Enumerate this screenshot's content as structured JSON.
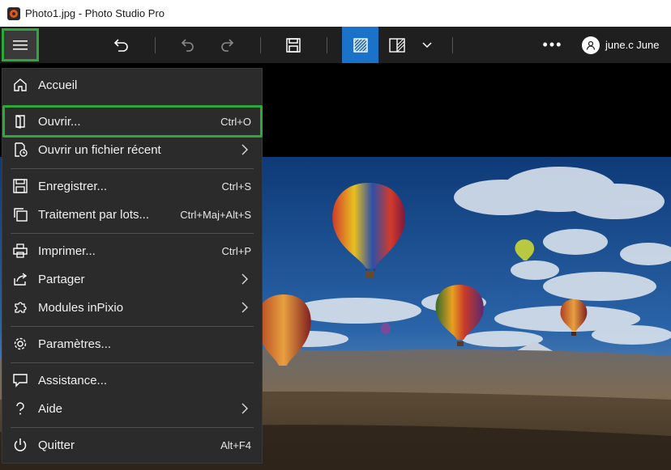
{
  "window": {
    "title": "Photo1.jpg - Photo Studio Pro"
  },
  "toolbar": {
    "menu_icon": "hamburger-icon",
    "more_label": "•••",
    "user_name": "june.c June"
  },
  "menu": {
    "items": [
      {
        "label": "Accueil",
        "shortcut": "",
        "icon": "home-icon",
        "submenu": false
      },
      {
        "label": "Ouvrir...",
        "shortcut": "Ctrl+O",
        "icon": "open-icon",
        "submenu": false
      },
      {
        "label": "Ouvrir un fichier récent",
        "shortcut": "",
        "icon": "recent-file-icon",
        "submenu": true
      },
      {
        "label": "Enregistrer...",
        "shortcut": "Ctrl+S",
        "icon": "save-icon",
        "submenu": false
      },
      {
        "label": "Traitement par lots...",
        "shortcut": "Ctrl+Maj+Alt+S",
        "icon": "batch-icon",
        "submenu": false
      },
      {
        "label": "Imprimer...",
        "shortcut": "Ctrl+P",
        "icon": "print-icon",
        "submenu": false
      },
      {
        "label": "Partager",
        "shortcut": "",
        "icon": "share-icon",
        "submenu": true
      },
      {
        "label": "Modules inPixio",
        "shortcut": "",
        "icon": "puzzle-icon",
        "submenu": true
      },
      {
        "label": "Paramètres...",
        "shortcut": "",
        "icon": "gear-icon",
        "submenu": false
      },
      {
        "label": "Assistance...",
        "shortcut": "",
        "icon": "chat-icon",
        "submenu": false
      },
      {
        "label": "Aide",
        "shortcut": "",
        "icon": "help-icon",
        "submenu": true
      },
      {
        "label": "Quitter",
        "shortcut": "Alt+F4",
        "icon": "power-icon",
        "submenu": false
      }
    ]
  },
  "colors": {
    "highlight": "#2fa83a",
    "active_tool": "#1a73c8",
    "menu_bg": "#2b2b2b",
    "toolbar_bg": "#1f1f1f"
  }
}
